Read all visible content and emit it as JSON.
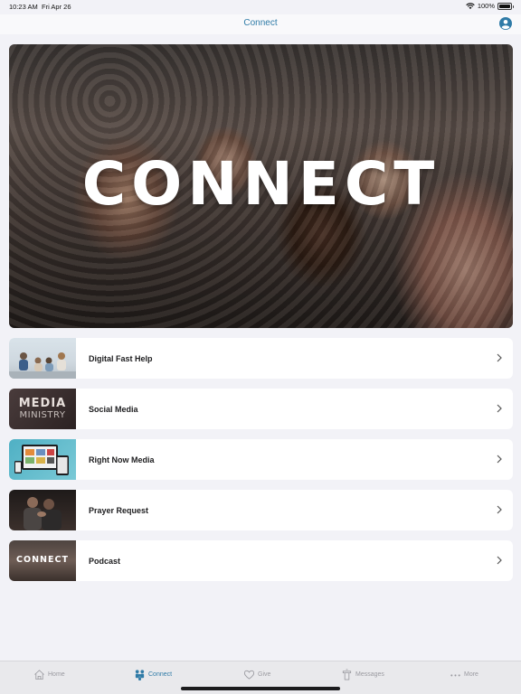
{
  "status_bar": {
    "time": "10:23 AM",
    "date": "Fri Apr 26",
    "battery": "100%"
  },
  "nav": {
    "title": "Connect"
  },
  "hero": {
    "title": "CONNECT"
  },
  "items": [
    {
      "label": "Digital Fast Help"
    },
    {
      "label": "Social Media",
      "thumb_line1": "MEDIA",
      "thumb_line2": "MINISTRY"
    },
    {
      "label": "Right Now Media"
    },
    {
      "label": "Prayer Request"
    },
    {
      "label": "Podcast",
      "thumb_text": "CONNECT"
    }
  ],
  "tabs": [
    {
      "label": "Home",
      "icon": "home-icon",
      "active": false
    },
    {
      "label": "Connect",
      "icon": "people-icon",
      "active": true
    },
    {
      "label": "Give",
      "icon": "heart-icon",
      "active": false
    },
    {
      "label": "Messages",
      "icon": "podium-icon",
      "active": false
    },
    {
      "label": "More",
      "icon": "more-dots-icon",
      "active": false
    }
  ],
  "colors": {
    "accent": "#2f7ba7",
    "background": "#f2f2f7",
    "tab_inactive": "#9a9aa0"
  }
}
